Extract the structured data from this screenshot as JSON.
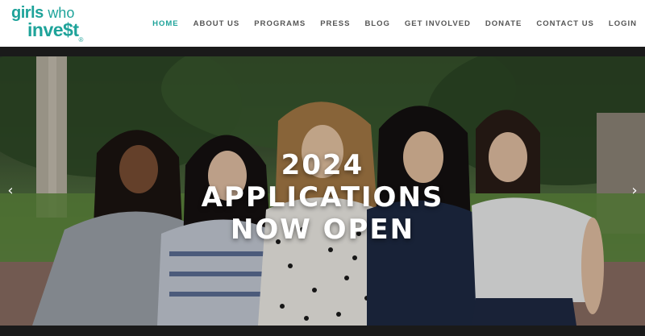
{
  "logo": {
    "line1_bold": "girls",
    "line1_light": "who",
    "line2": "inve$t",
    "trademark": "®"
  },
  "nav": {
    "items": [
      {
        "label": "HOME",
        "active": true
      },
      {
        "label": "ABOUT US"
      },
      {
        "label": "PROGRAMS"
      },
      {
        "label": "PRESS"
      },
      {
        "label": "BLOG"
      },
      {
        "label": "GET INVOLVED"
      },
      {
        "label": "DONATE"
      },
      {
        "label": "CONTACT US"
      },
      {
        "label": "LOGIN"
      }
    ]
  },
  "hero": {
    "headline": [
      "2024",
      "APPLICATIONS",
      "NOW OPEN"
    ],
    "prev_arrow": "‹",
    "next_arrow": "›",
    "accent_color": "#1ea39a"
  }
}
